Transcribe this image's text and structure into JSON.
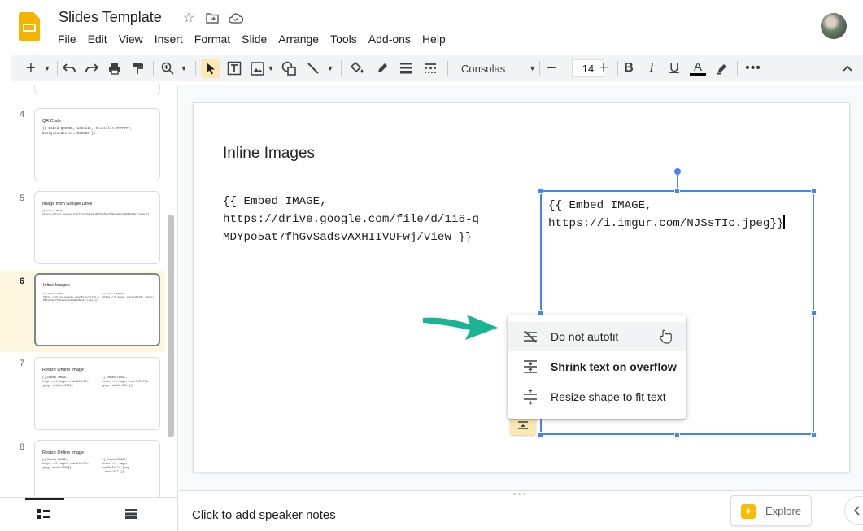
{
  "app": {
    "title": "Slides Template",
    "menu": [
      "File",
      "Edit",
      "View",
      "Insert",
      "Format",
      "Slide",
      "Arrange",
      "Tools",
      "Add-ons",
      "Help"
    ]
  },
  "toolbar": {
    "font_name": "Consolas",
    "font_size": "14"
  },
  "filmstrip": {
    "slides": [
      {
        "num": "4",
        "title": "QR Code",
        "body": "{{ Embed QRCODE, Website, textcolor=#FFFFFF,\nbackgroundcolor=#000000 }}"
      },
      {
        "num": "5",
        "title": "Image from Google Drive",
        "body": "{{ Embed IMAGE,\nhttps://drive.google.com/file/d/1i6-qMDYpo5at7fhGvSadsvAXHIIVUFwj/view }}"
      },
      {
        "num": "6",
        "title": "Inline Images",
        "body": "{{ Embed IMAGE,\nhttps://drive.google.com/file/d/1i6-q\nMDYpo5at7fhGvSadsvAXHIIVUFwj/view }}",
        "body2": "{{ Embed IMAGE,\nhttps://i.imgur.com/NJSsTIc.jpeg}}"
      },
      {
        "num": "7",
        "title": "Resize Online Image",
        "body": "[{ Embed IMAGE,\nhttps://i.imgur.com/NJSsTIc.\njpeg, height=200}]",
        "body2": "[{ Embed IMAGE,\nhttps://i.imgur.com/NJSsTIc.\njpeg, width=200 }]"
      },
      {
        "num": "8",
        "title": "Resize Online Image",
        "body": "[{ Embed IMAGE,\nhttps://i.imgur.com/NJSsTIc.\njpeg, mode=CROP]]",
        "body2": "[{ Embed IMAGE,\nhttps://i.imgur.\ncom/NJSsTIc.jpeg\n, mode=FIT }]"
      }
    ]
  },
  "slide": {
    "title": "Inline Images",
    "left_text": "{{ Embed IMAGE,\nhttps://drive.google.com/file/d/1i6-q\nMDYpo5at7fhGvSadsvAXHIIVUFwj/view }}",
    "right_text": "{{ Embed IMAGE,\nhttps://i.imgur.com/NJSsTIc.jpeg}}"
  },
  "autofit_menu": {
    "items": [
      {
        "label": "Do not autofit"
      },
      {
        "label": "Shrink text on overflow"
      },
      {
        "label": "Resize shape to fit text"
      }
    ]
  },
  "notes": {
    "placeholder": "Click to add speaker notes"
  },
  "explore": {
    "label": "Explore"
  },
  "colors": {
    "accent_yellow": "#fce8b2",
    "selection_blue": "#4285f4",
    "annotation_arrow": "#1ab394"
  }
}
